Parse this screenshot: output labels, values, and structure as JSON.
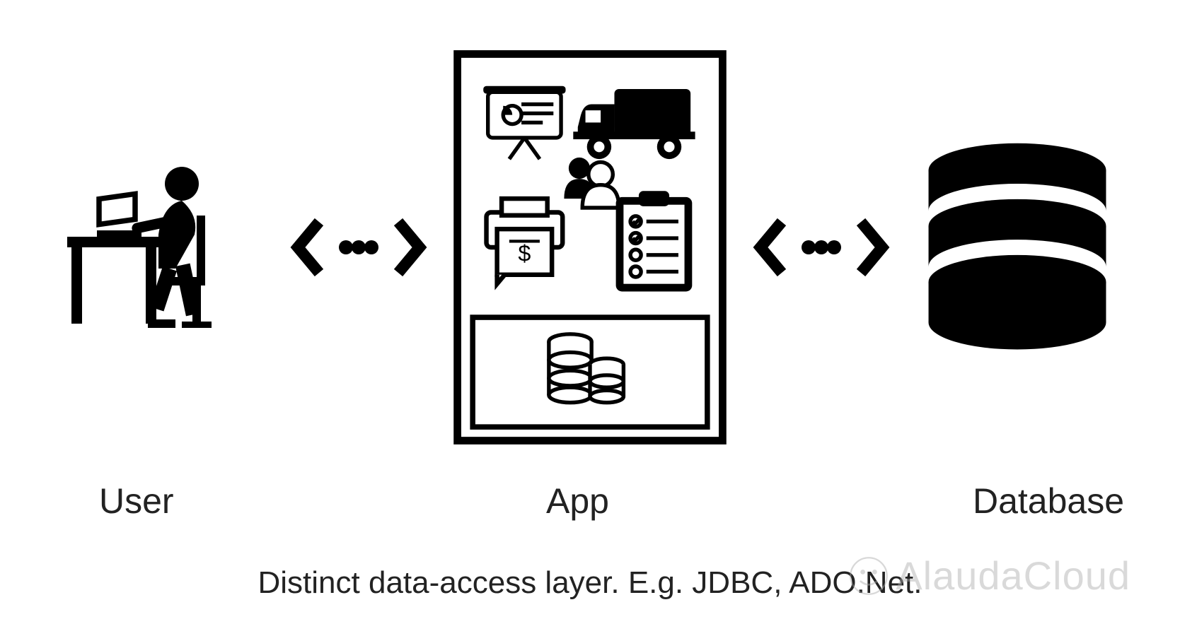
{
  "labels": {
    "user": "User",
    "app": "App",
    "database": "Database"
  },
  "caption": "Distinct data-access layer. E.g. JDBC, ADO.Net.",
  "watermark": "AlaudaCloud",
  "icons": {
    "user": "person-at-desk-icon",
    "connector_left": "bidirectional-arrow-icon",
    "connector_right": "bidirectional-arrow-icon",
    "database": "database-cylinder-icon",
    "app_box": {
      "presentation": "presentation-chart-icon",
      "truck": "delivery-truck-icon",
      "people": "people-group-icon",
      "invoice": "invoice-dollar-icon",
      "checklist": "clipboard-checklist-icon",
      "data_layer": "database-pair-icon"
    }
  }
}
